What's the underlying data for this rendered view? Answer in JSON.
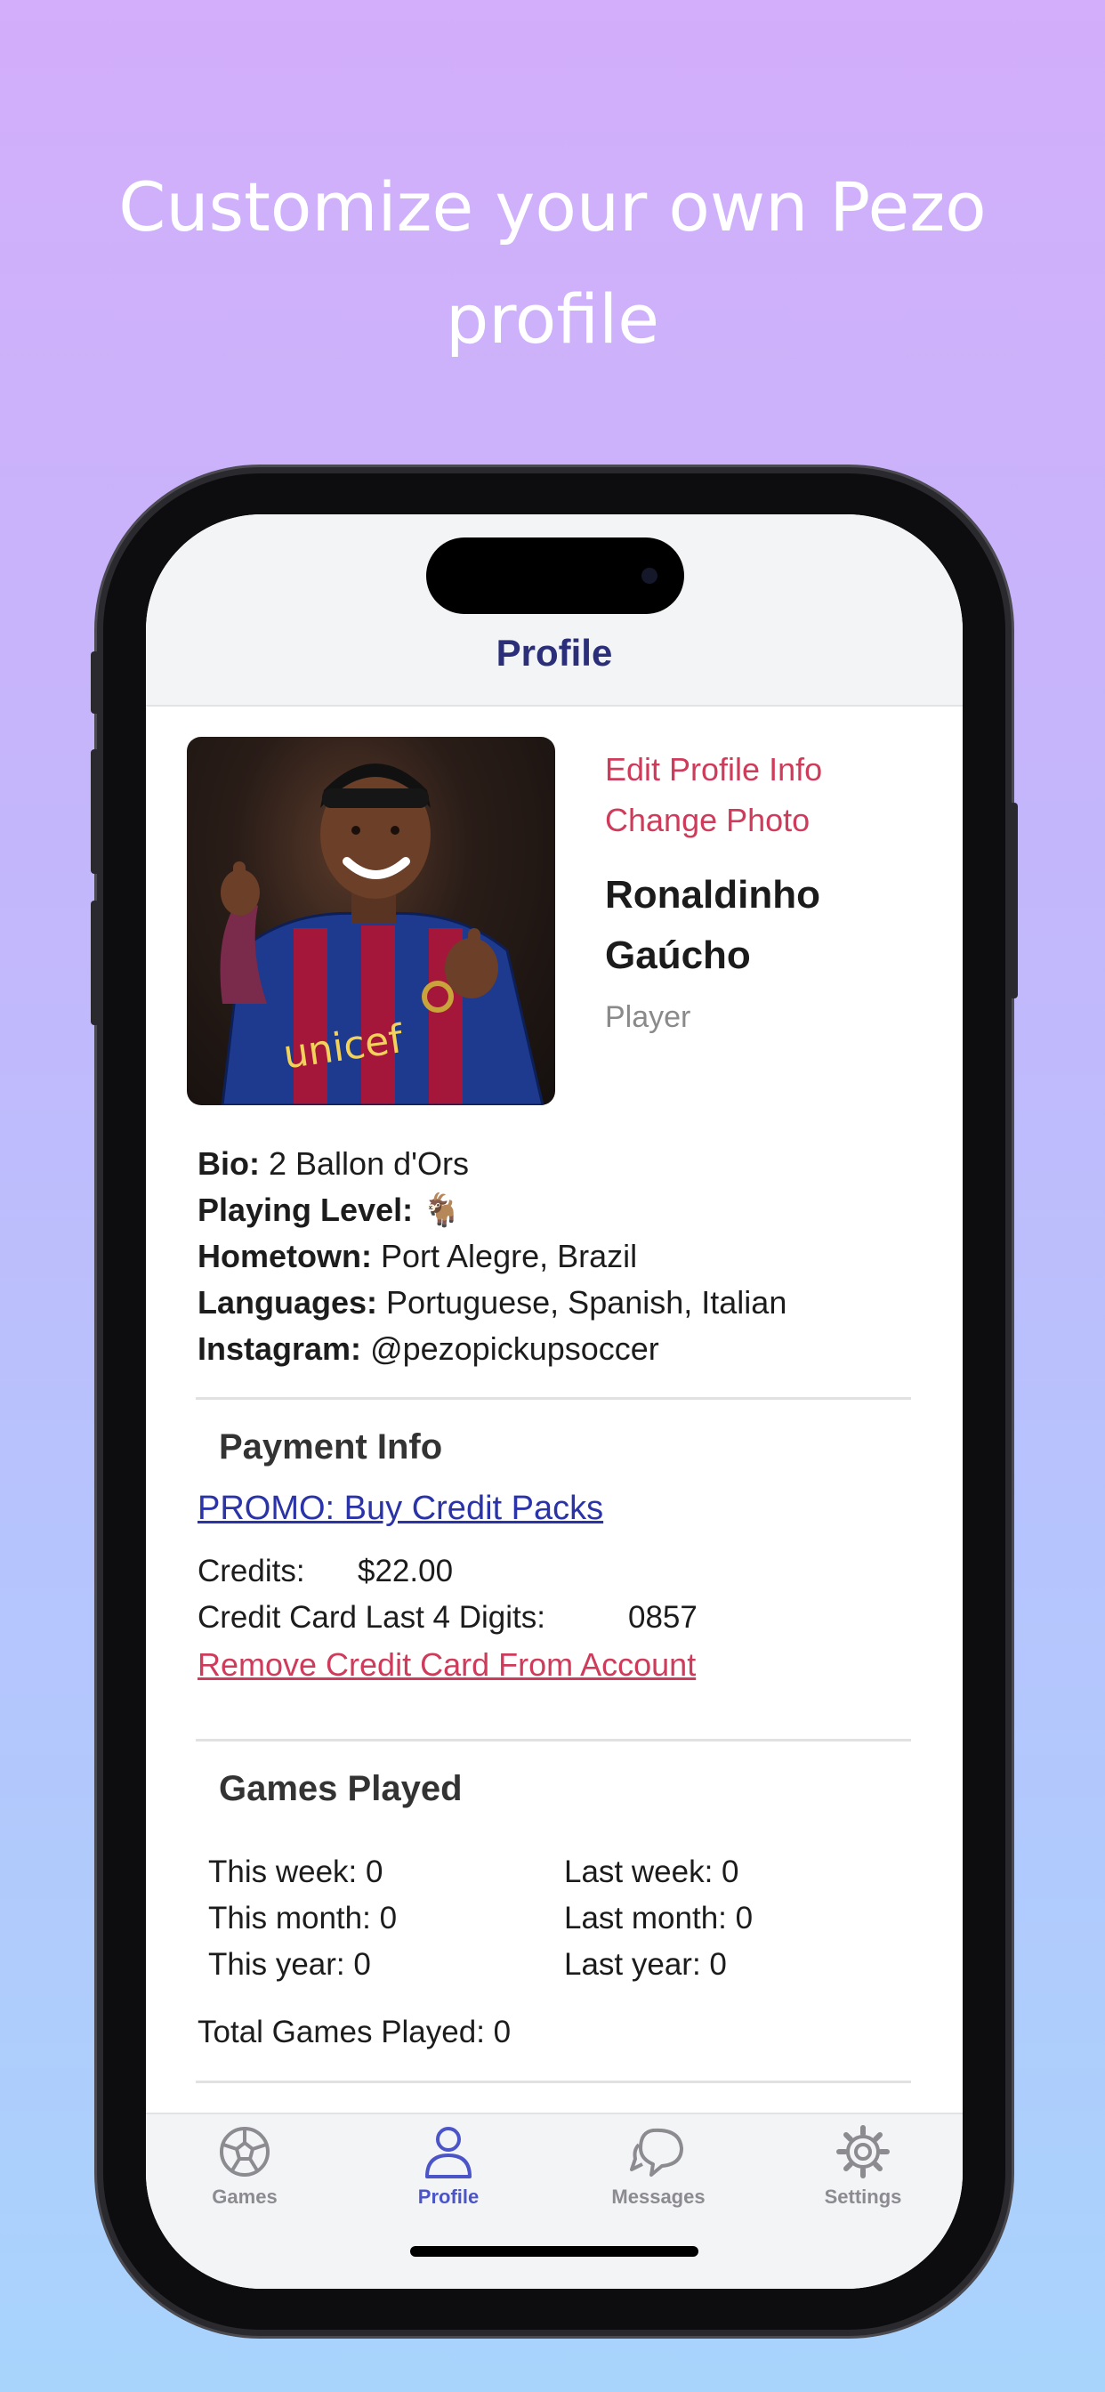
{
  "headline": {
    "line1": "Customize your own Pezo",
    "line2": "profile"
  },
  "nav": {
    "title": "Profile"
  },
  "profile": {
    "edit_link": "Edit Profile Info",
    "photo_link": "Change Photo",
    "first_name": "Ronaldinho",
    "last_name": "Gaúcho",
    "role": "Player"
  },
  "details": {
    "bio_label": "Bio:",
    "bio_value": "2 Ballon d'Ors",
    "level_label": "Playing Level:",
    "level_value": "🐐",
    "hometown_label": "Hometown:",
    "hometown_value": "Port Alegre, Brazil",
    "languages_label": "Languages:",
    "languages_value": "Portuguese, Spanish, Italian",
    "instagram_label": "Instagram:",
    "instagram_value": "@pezopickupsoccer"
  },
  "payment": {
    "title": "Payment Info",
    "promo": "PROMO: Buy Credit Packs",
    "credits_label": "Credits:",
    "credits_value": "$22.00",
    "card_label": "Credit Card Last 4 Digits:",
    "card_value": "0857",
    "remove": "Remove Credit Card From Account"
  },
  "games": {
    "title": "Games Played",
    "this_week": "This week: 0",
    "last_week": "Last week: 0",
    "this_month": "This month: 0",
    "last_month": "Last month: 0",
    "this_year": "This year: 0",
    "last_year": "Last year: 0",
    "total": "Total Games Played: 0"
  },
  "tabs": [
    {
      "label": "Games",
      "icon": "soccer-ball-icon"
    },
    {
      "label": "Profile",
      "icon": "person-icon",
      "active": true
    },
    {
      "label": "Messages",
      "icon": "chat-bubbles-icon"
    },
    {
      "label": "Settings",
      "icon": "gear-icon"
    }
  ],
  "colors": {
    "accent": "#4b55c8",
    "link_red": "#cf3b5a",
    "title": "#2b2f7a"
  }
}
